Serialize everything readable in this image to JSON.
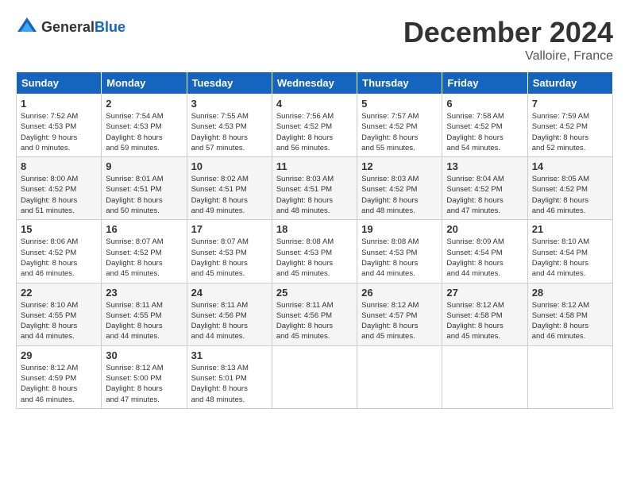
{
  "header": {
    "logo_general": "General",
    "logo_blue": "Blue",
    "month_year": "December 2024",
    "location": "Valloire, France"
  },
  "weekdays": [
    "Sunday",
    "Monday",
    "Tuesday",
    "Wednesday",
    "Thursday",
    "Friday",
    "Saturday"
  ],
  "weeks": [
    [
      {
        "day": "1",
        "sunrise": "7:52 AM",
        "sunset": "4:53 PM",
        "daylight": "9 hours and 0 minutes."
      },
      {
        "day": "2",
        "sunrise": "7:54 AM",
        "sunset": "4:53 PM",
        "daylight": "8 hours and 59 minutes."
      },
      {
        "day": "3",
        "sunrise": "7:55 AM",
        "sunset": "4:53 PM",
        "daylight": "8 hours and 57 minutes."
      },
      {
        "day": "4",
        "sunrise": "7:56 AM",
        "sunset": "4:52 PM",
        "daylight": "8 hours and 56 minutes."
      },
      {
        "day": "5",
        "sunrise": "7:57 AM",
        "sunset": "4:52 PM",
        "daylight": "8 hours and 55 minutes."
      },
      {
        "day": "6",
        "sunrise": "7:58 AM",
        "sunset": "4:52 PM",
        "daylight": "8 hours and 54 minutes."
      },
      {
        "day": "7",
        "sunrise": "7:59 AM",
        "sunset": "4:52 PM",
        "daylight": "8 hours and 52 minutes."
      }
    ],
    [
      {
        "day": "8",
        "sunrise": "8:00 AM",
        "sunset": "4:52 PM",
        "daylight": "8 hours and 51 minutes."
      },
      {
        "day": "9",
        "sunrise": "8:01 AM",
        "sunset": "4:51 PM",
        "daylight": "8 hours and 50 minutes."
      },
      {
        "day": "10",
        "sunrise": "8:02 AM",
        "sunset": "4:51 PM",
        "daylight": "8 hours and 49 minutes."
      },
      {
        "day": "11",
        "sunrise": "8:03 AM",
        "sunset": "4:51 PM",
        "daylight": "8 hours and 48 minutes."
      },
      {
        "day": "12",
        "sunrise": "8:03 AM",
        "sunset": "4:52 PM",
        "daylight": "8 hours and 48 minutes."
      },
      {
        "day": "13",
        "sunrise": "8:04 AM",
        "sunset": "4:52 PM",
        "daylight": "8 hours and 47 minutes."
      },
      {
        "day": "14",
        "sunrise": "8:05 AM",
        "sunset": "4:52 PM",
        "daylight": "8 hours and 46 minutes."
      }
    ],
    [
      {
        "day": "15",
        "sunrise": "8:06 AM",
        "sunset": "4:52 PM",
        "daylight": "8 hours and 46 minutes."
      },
      {
        "day": "16",
        "sunrise": "8:07 AM",
        "sunset": "4:52 PM",
        "daylight": "8 hours and 45 minutes."
      },
      {
        "day": "17",
        "sunrise": "8:07 AM",
        "sunset": "4:53 PM",
        "daylight": "8 hours and 45 minutes."
      },
      {
        "day": "18",
        "sunrise": "8:08 AM",
        "sunset": "4:53 PM",
        "daylight": "8 hours and 45 minutes."
      },
      {
        "day": "19",
        "sunrise": "8:08 AM",
        "sunset": "4:53 PM",
        "daylight": "8 hours and 44 minutes."
      },
      {
        "day": "20",
        "sunrise": "8:09 AM",
        "sunset": "4:54 PM",
        "daylight": "8 hours and 44 minutes."
      },
      {
        "day": "21",
        "sunrise": "8:10 AM",
        "sunset": "4:54 PM",
        "daylight": "8 hours and 44 minutes."
      }
    ],
    [
      {
        "day": "22",
        "sunrise": "8:10 AM",
        "sunset": "4:55 PM",
        "daylight": "8 hours and 44 minutes."
      },
      {
        "day": "23",
        "sunrise": "8:11 AM",
        "sunset": "4:55 PM",
        "daylight": "8 hours and 44 minutes."
      },
      {
        "day": "24",
        "sunrise": "8:11 AM",
        "sunset": "4:56 PM",
        "daylight": "8 hours and 44 minutes."
      },
      {
        "day": "25",
        "sunrise": "8:11 AM",
        "sunset": "4:56 PM",
        "daylight": "8 hours and 45 minutes."
      },
      {
        "day": "26",
        "sunrise": "8:12 AM",
        "sunset": "4:57 PM",
        "daylight": "8 hours and 45 minutes."
      },
      {
        "day": "27",
        "sunrise": "8:12 AM",
        "sunset": "4:58 PM",
        "daylight": "8 hours and 45 minutes."
      },
      {
        "day": "28",
        "sunrise": "8:12 AM",
        "sunset": "4:58 PM",
        "daylight": "8 hours and 46 minutes."
      }
    ],
    [
      {
        "day": "29",
        "sunrise": "8:12 AM",
        "sunset": "4:59 PM",
        "daylight": "8 hours and 46 minutes."
      },
      {
        "day": "30",
        "sunrise": "8:12 AM",
        "sunset": "5:00 PM",
        "daylight": "8 hours and 47 minutes."
      },
      {
        "day": "31",
        "sunrise": "8:13 AM",
        "sunset": "5:01 PM",
        "daylight": "8 hours and 48 minutes."
      },
      null,
      null,
      null,
      null
    ]
  ]
}
